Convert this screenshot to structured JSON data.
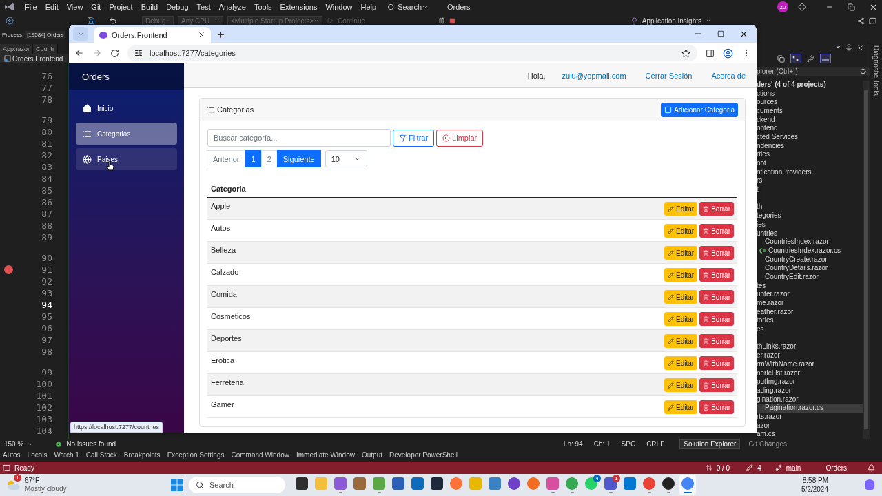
{
  "vs": {
    "menu": [
      "File",
      "Edit",
      "View",
      "Git",
      "Project",
      "Build",
      "Debug",
      "Test",
      "Analyze",
      "Tools",
      "Extensions",
      "Window",
      "Help"
    ],
    "search": "Search",
    "solution_name": "Orders",
    "avatar": "ZJ",
    "toolbar": {
      "configuration": "Debug",
      "platform": "Any CPU",
      "startup": "<Multiple Startup Projects>",
      "continue": "Continue",
      "insights": "Application Insights"
    },
    "process_label": "Process:",
    "process": "[19584] Orders",
    "doc_tabs": [
      "App.razor",
      "Countr"
    ],
    "nav_file": "Orders.Frontend",
    "lines": [
      {
        "n": "76",
        "codelens": false,
        "breakpoint": false,
        "current": false
      },
      {
        "n": "77",
        "codelens": false,
        "breakpoint": false,
        "current": false
      },
      {
        "n": "78",
        "codelens": false,
        "breakpoint": false,
        "current": false
      },
      {
        "n": "79",
        "codelens": true,
        "breakpoint": false,
        "current": false
      },
      {
        "n": "80",
        "codelens": false,
        "breakpoint": false,
        "current": false
      },
      {
        "n": "81",
        "codelens": false,
        "breakpoint": false,
        "current": false
      },
      {
        "n": "82",
        "codelens": false,
        "breakpoint": false,
        "current": false
      },
      {
        "n": "83",
        "codelens": false,
        "breakpoint": false,
        "current": false
      },
      {
        "n": "84",
        "codelens": false,
        "breakpoint": false,
        "current": false
      },
      {
        "n": "85",
        "codelens": false,
        "breakpoint": false,
        "current": false
      },
      {
        "n": "86",
        "codelens": false,
        "breakpoint": false,
        "current": false
      },
      {
        "n": "87",
        "codelens": false,
        "breakpoint": false,
        "current": false
      },
      {
        "n": "88",
        "codelens": false,
        "breakpoint": false,
        "current": false
      },
      {
        "n": "89",
        "codelens": false,
        "breakpoint": false,
        "current": false
      },
      {
        "n": "90",
        "codelens": true,
        "breakpoint": false,
        "current": false
      },
      {
        "n": "91",
        "codelens": false,
        "breakpoint": true,
        "current": false
      },
      {
        "n": "92",
        "codelens": false,
        "breakpoint": false,
        "current": false
      },
      {
        "n": "93",
        "codelens": false,
        "breakpoint": false,
        "current": false
      },
      {
        "n": "94",
        "codelens": false,
        "breakpoint": false,
        "current": true
      },
      {
        "n": "95",
        "codelens": false,
        "breakpoint": false,
        "current": false
      },
      {
        "n": "96",
        "codelens": false,
        "breakpoint": false,
        "current": false
      },
      {
        "n": "97",
        "codelens": false,
        "breakpoint": false,
        "current": false
      },
      {
        "n": "98",
        "codelens": false,
        "breakpoint": false,
        "current": false
      },
      {
        "n": "99",
        "codelens": true,
        "breakpoint": false,
        "current": false
      },
      {
        "n": "100",
        "codelens": false,
        "breakpoint": false,
        "current": false
      },
      {
        "n": "101",
        "codelens": false,
        "breakpoint": false,
        "current": false
      },
      {
        "n": "102",
        "codelens": false,
        "breakpoint": false,
        "current": false
      },
      {
        "n": "103",
        "codelens": false,
        "breakpoint": false,
        "current": false
      },
      {
        "n": "104",
        "codelens": false,
        "breakpoint": false,
        "current": false
      }
    ],
    "solution_explorer": {
      "search_placeholder": "plorer (Ctrl+´)",
      "items": [
        {
          "kind": "header",
          "text": "ders' (4 of 4 projects)",
          "selected": false
        },
        {
          "kind": "item",
          "text": "ctions",
          "selected": false
        },
        {
          "kind": "item",
          "text": "ources",
          "selected": false
        },
        {
          "kind": "item",
          "text": "cuments",
          "selected": false
        },
        {
          "kind": "item",
          "text": "ckend",
          "selected": false
        },
        {
          "kind": "item",
          "text": "ontend",
          "selected": false
        },
        {
          "kind": "item",
          "text": "cted Services",
          "selected": false
        },
        {
          "kind": "item",
          "text": "ndencies",
          "selected": false
        },
        {
          "kind": "item",
          "text": "rties",
          "selected": false
        },
        {
          "kind": "item",
          "text": "oot",
          "selected": false
        },
        {
          "kind": "item",
          "text": "nticationProviders",
          "selected": false
        },
        {
          "kind": "item",
          "text": "rs",
          "selected": false
        },
        {
          "kind": "item",
          "text": "t",
          "selected": false
        },
        {
          "kind": "blank",
          "selected": false
        },
        {
          "kind": "item",
          "text": "th",
          "selected": false
        },
        {
          "kind": "item",
          "text": "tegories",
          "selected": false
        },
        {
          "kind": "item",
          "text": "ies",
          "selected": false
        },
        {
          "kind": "item",
          "text": "untries",
          "selected": false
        },
        {
          "kind": "item",
          "text": "CountriesIndex.razor",
          "selected": false
        },
        {
          "kind": "csharp",
          "text": "CountriesIndex.razor.cs",
          "selected": false
        },
        {
          "kind": "item",
          "text": "CountryCreate.razor",
          "selected": false
        },
        {
          "kind": "item",
          "text": "CountryDetails.razor",
          "selected": false
        },
        {
          "kind": "item",
          "text": "CountryEdit.razor",
          "selected": false
        },
        {
          "kind": "item",
          "text": "tes",
          "selected": false
        },
        {
          "kind": "item",
          "text": "unter.razor",
          "selected": false
        },
        {
          "kind": "item",
          "text": "me.razor",
          "selected": false
        },
        {
          "kind": "item",
          "text": "eather.razor",
          "selected": false
        },
        {
          "kind": "item",
          "text": "tories",
          "selected": false
        },
        {
          "kind": "item",
          "text": "es",
          "selected": false
        },
        {
          "kind": "blank",
          "selected": false
        },
        {
          "kind": "item",
          "text": "thLinks.razor",
          "selected": false
        },
        {
          "kind": "item",
          "text": "er.razor",
          "selected": false
        },
        {
          "kind": "item",
          "text": "rmWithName.razor",
          "selected": false
        },
        {
          "kind": "item",
          "text": "nericList.razor",
          "selected": false
        },
        {
          "kind": "item",
          "text": "putImg.razor",
          "selected": false
        },
        {
          "kind": "item",
          "text": "ading.razor",
          "selected": false
        },
        {
          "kind": "item",
          "text": "gination.razor",
          "selected": false
        },
        {
          "kind": "item",
          "text": "Pagination.razor.cs",
          "selected": true
        },
        {
          "kind": "item",
          "text": "rts.razor",
          "selected": false
        },
        {
          "kind": "item",
          "text": "azor",
          "selected": false
        },
        {
          "kind": "item",
          "text": "am.cs",
          "selected": false
        }
      ]
    },
    "diagnostics_tab": "Diagnostic Tools",
    "zoom": "150 %",
    "issues": "No issues found",
    "cursor": {
      "line": "Ln: 94",
      "col": "Ch: 1",
      "indent": "SPC",
      "eol": "CRLF"
    },
    "panel_tabs": [
      {
        "label": "Solution Explorer",
        "selected": true
      },
      {
        "label": "Git Changes",
        "selected": false
      }
    ],
    "tool_tabs": [
      "Autos",
      "Locals",
      "Watch 1",
      "Call Stack",
      "Breakpoints",
      "Exception Settings",
      "Command Window",
      "Immediate Window",
      "Output",
      "Developer PowerShell"
    ],
    "status": {
      "text": "Ready",
      "sync": "0 / 0",
      "edits": "4",
      "branch": "main",
      "repo": "Orders"
    }
  },
  "browser": {
    "tab_title": "Orders.Frontend",
    "url": "localhost:7277/categories",
    "status_url": "https://localhost:7277/countries",
    "app": {
      "brand": "Orders",
      "nav": [
        {
          "kind": "home",
          "label": "Inicio",
          "selected": false,
          "hovered": false
        },
        {
          "kind": "list",
          "label": "Categorias",
          "selected": true,
          "hovered": false
        },
        {
          "kind": "globe",
          "label": "Paises",
          "selected": false,
          "hovered": true
        }
      ],
      "greeting": "Hola,",
      "user": "zulu@yopmail.com",
      "logout": "Cerrar Sesión",
      "about": "Acerca de",
      "card_title": "Categorias",
      "add_button": "Adicionar Categoria",
      "search_placeholder": "Buscar categoría...",
      "filter_button": "Filtrar",
      "clear_button": "Limpiar",
      "pagination": [
        {
          "kind": "prev",
          "label": "Anterior",
          "selected": false
        },
        {
          "kind": "page",
          "label": "1",
          "selected": true
        },
        {
          "kind": "page",
          "label": "2",
          "selected": false
        },
        {
          "kind": "next",
          "label": "Siguiente",
          "selected": false
        }
      ],
      "page_size": "10",
      "column": "Categoria",
      "rows": [
        {
          "name": "Apple",
          "edit": "Editar",
          "delete": "Borrar"
        },
        {
          "name": "Autos",
          "edit": "Editar",
          "delete": "Borrar"
        },
        {
          "name": "Belleza",
          "edit": "Editar",
          "delete": "Borrar"
        },
        {
          "name": "Calzado",
          "edit": "Editar",
          "delete": "Borrar"
        },
        {
          "name": "Comida",
          "edit": "Editar",
          "delete": "Borrar"
        },
        {
          "name": "Cosmeticos",
          "edit": "Editar",
          "delete": "Borrar"
        },
        {
          "name": "Deportes",
          "edit": "Editar",
          "delete": "Borrar"
        },
        {
          "name": "Erótica",
          "edit": "Editar",
          "delete": "Borrar"
        },
        {
          "name": "Ferreteria",
          "edit": "Editar",
          "delete": "Borrar"
        },
        {
          "name": "Gamer",
          "edit": "Editar",
          "delete": "Borrar"
        }
      ]
    }
  },
  "taskbar": {
    "weather_badge": "1",
    "temperature": "67°F",
    "condition": "Mostly cloudy",
    "search": "Search",
    "time": "8:58 PM",
    "date": "5/2/2024",
    "apps": [
      {
        "running": false,
        "selected": false
      },
      {
        "running": false,
        "selected": false
      },
      {
        "running": true,
        "selected": false
      },
      {
        "running": false,
        "selected": false
      },
      {
        "running": true,
        "selected": false
      },
      {
        "running": false,
        "selected": false
      },
      {
        "running": false,
        "selected": false
      },
      {
        "running": false,
        "selected": false
      },
      {
        "running": false,
        "selected": false
      },
      {
        "running": false,
        "selected": false
      },
      {
        "running": false,
        "selected": false
      },
      {
        "running": false,
        "selected": false
      },
      {
        "running": false,
        "selected": false
      },
      {
        "running": true,
        "selected": false
      },
      {
        "running": true,
        "selected": false
      },
      {
        "running": false,
        "selected": false,
        "badge": "4"
      },
      {
        "running": true,
        "selected": false,
        "badge": "1"
      },
      {
        "running": false,
        "selected": false
      },
      {
        "running": true,
        "selected": false
      },
      {
        "running": true,
        "selected": false
      },
      {
        "running": true,
        "selected": true
      }
    ]
  }
}
